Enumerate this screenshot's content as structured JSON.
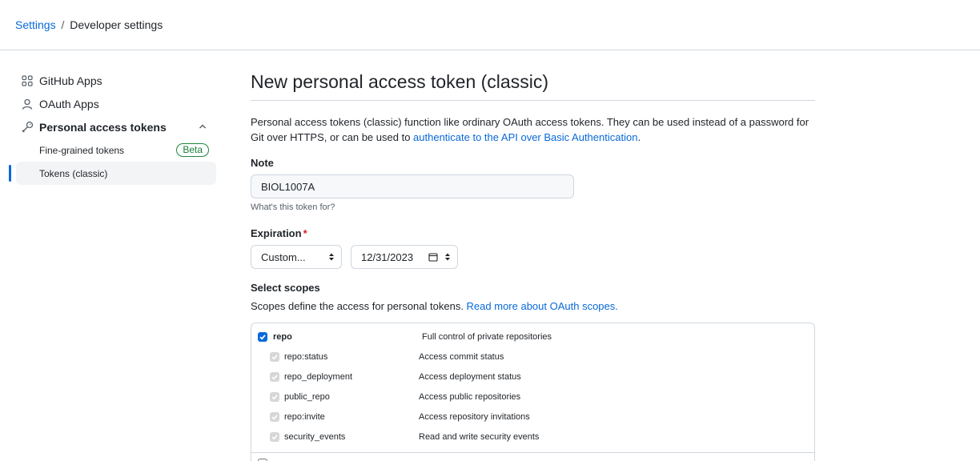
{
  "breadcrumb": {
    "parent": "Settings",
    "separator": "/",
    "current": "Developer settings"
  },
  "sidebar": {
    "items": [
      {
        "label": "GitHub Apps",
        "icon": "apps-grid-icon"
      },
      {
        "label": "OAuth Apps",
        "icon": "person-icon"
      },
      {
        "label": "Personal access tokens",
        "icon": "key-icon",
        "expanded": true
      }
    ],
    "sub_items": [
      {
        "label": "Fine-grained tokens",
        "badge": "Beta"
      },
      {
        "label": "Tokens (classic)",
        "active": true
      }
    ]
  },
  "main": {
    "title": "New personal access token (classic)",
    "description": "Personal access tokens (classic) function like ordinary OAuth access tokens. They can be used instead of a password for Git over HTTPS, or can be used to ",
    "description_link": "authenticate to the API over Basic Authentication",
    "description_end": ".",
    "note": {
      "label": "Note",
      "value": "BIOL1007A",
      "hint": "What's this token for?"
    },
    "expiration": {
      "label": "Expiration",
      "required_mark": "*",
      "select_value": "Custom...",
      "date_value": "12/31/2023"
    },
    "scopes": {
      "label": "Select scopes",
      "description": "Scopes define the access for personal tokens. ",
      "description_link": "Read more about OAuth scopes.",
      "rows": [
        {
          "name": "repo",
          "desc": "Full control of private repositories",
          "checked": true,
          "parent": true
        },
        {
          "name": "repo:status",
          "desc": "Access commit status",
          "checked": true,
          "parent": false
        },
        {
          "name": "repo_deployment",
          "desc": "Access deployment status",
          "checked": true,
          "parent": false
        },
        {
          "name": "public_repo",
          "desc": "Access public repositories",
          "checked": true,
          "parent": false
        },
        {
          "name": "repo:invite",
          "desc": "Access repository invitations",
          "checked": true,
          "parent": false
        },
        {
          "name": "security_events",
          "desc": "Read and write security events",
          "checked": true,
          "parent": false
        }
      ]
    }
  },
  "colors": {
    "accent": "#0969da",
    "border": "#d0d7de",
    "beta": "#1a7f37",
    "required": "#cf222e"
  }
}
